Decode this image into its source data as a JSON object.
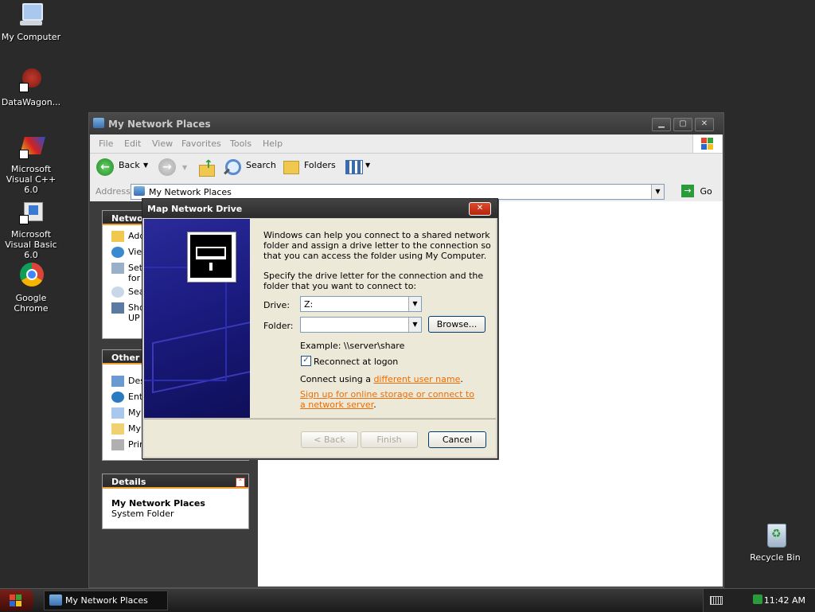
{
  "desktop": {
    "icons": [
      {
        "label": "My Computer"
      },
      {
        "label": "DataWagon..."
      },
      {
        "label": "Microsoft Visual C++ 6.0"
      },
      {
        "label": "Microsoft Visual Basic 6.0"
      },
      {
        "label": "Google Chrome"
      },
      {
        "label": "Recycle Bin"
      }
    ]
  },
  "window": {
    "title": "My Network Places",
    "menu": [
      "File",
      "Edit",
      "View",
      "Favorites",
      "Tools",
      "Help"
    ],
    "toolbar": {
      "back": "Back",
      "search": "Search",
      "folders": "Folders"
    },
    "address": {
      "label": "Address",
      "value": "My Network Places",
      "go": "Go"
    },
    "network_tasks": {
      "header": "Networ",
      "items": [
        "Add",
        "Vie",
        "Set",
        "for",
        "Sea",
        "Sho",
        "UP"
      ]
    },
    "other_places": {
      "header": "Other P",
      "items": [
        "Des",
        "Ent",
        "My",
        "My",
        "Prin"
      ]
    },
    "details": {
      "header": "Details",
      "name": "My Network Places",
      "type": "System Folder"
    }
  },
  "dialog": {
    "title": "Map Network Drive",
    "intro": "Windows can help you connect to a shared network folder and assign a drive letter to the connection so that you can access the folder using My Computer.",
    "specify": "Specify the drive letter for the connection and the folder that you want to connect to:",
    "drive_label": "Drive:",
    "drive_value": "Z:",
    "folder_label": "Folder:",
    "folder_value": "",
    "browse": "Browse...",
    "example": "Example: \\\\server\\share",
    "reconnect": "Reconnect at logon",
    "reconnect_checked": true,
    "connect_prefix": "Connect using a",
    "connect_link": "different user name",
    "connect_suffix": ".",
    "signup_link": "Sign up for online storage or connect to a network server",
    "signup_suffix": ".",
    "back": "< Back",
    "finish": "Finish",
    "cancel": "Cancel"
  },
  "taskbar": {
    "task": "My Network Places",
    "clock": "11:42 AM"
  }
}
